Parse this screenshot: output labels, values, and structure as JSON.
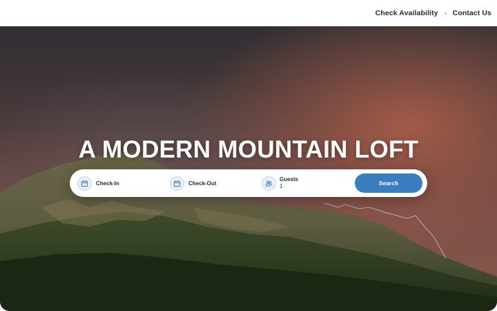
{
  "nav": {
    "check_availability": "Check Availability",
    "contact_us": "Contact Us"
  },
  "hero": {
    "headline": "A MODERN MOUNTAIN LOFT"
  },
  "search": {
    "check_in_label": "Check-In",
    "check_out_label": "Check-Out",
    "guests_label": "Guests",
    "guests_value": "1",
    "button_label": "Search"
  },
  "colors": {
    "accent": "#3b7dc1",
    "icon_bg": "#e8f0f9",
    "text": "#1f2a37"
  },
  "icons": {
    "check_in": "calendar-icon",
    "check_out": "calendar-icon",
    "guests": "users-icon"
  }
}
